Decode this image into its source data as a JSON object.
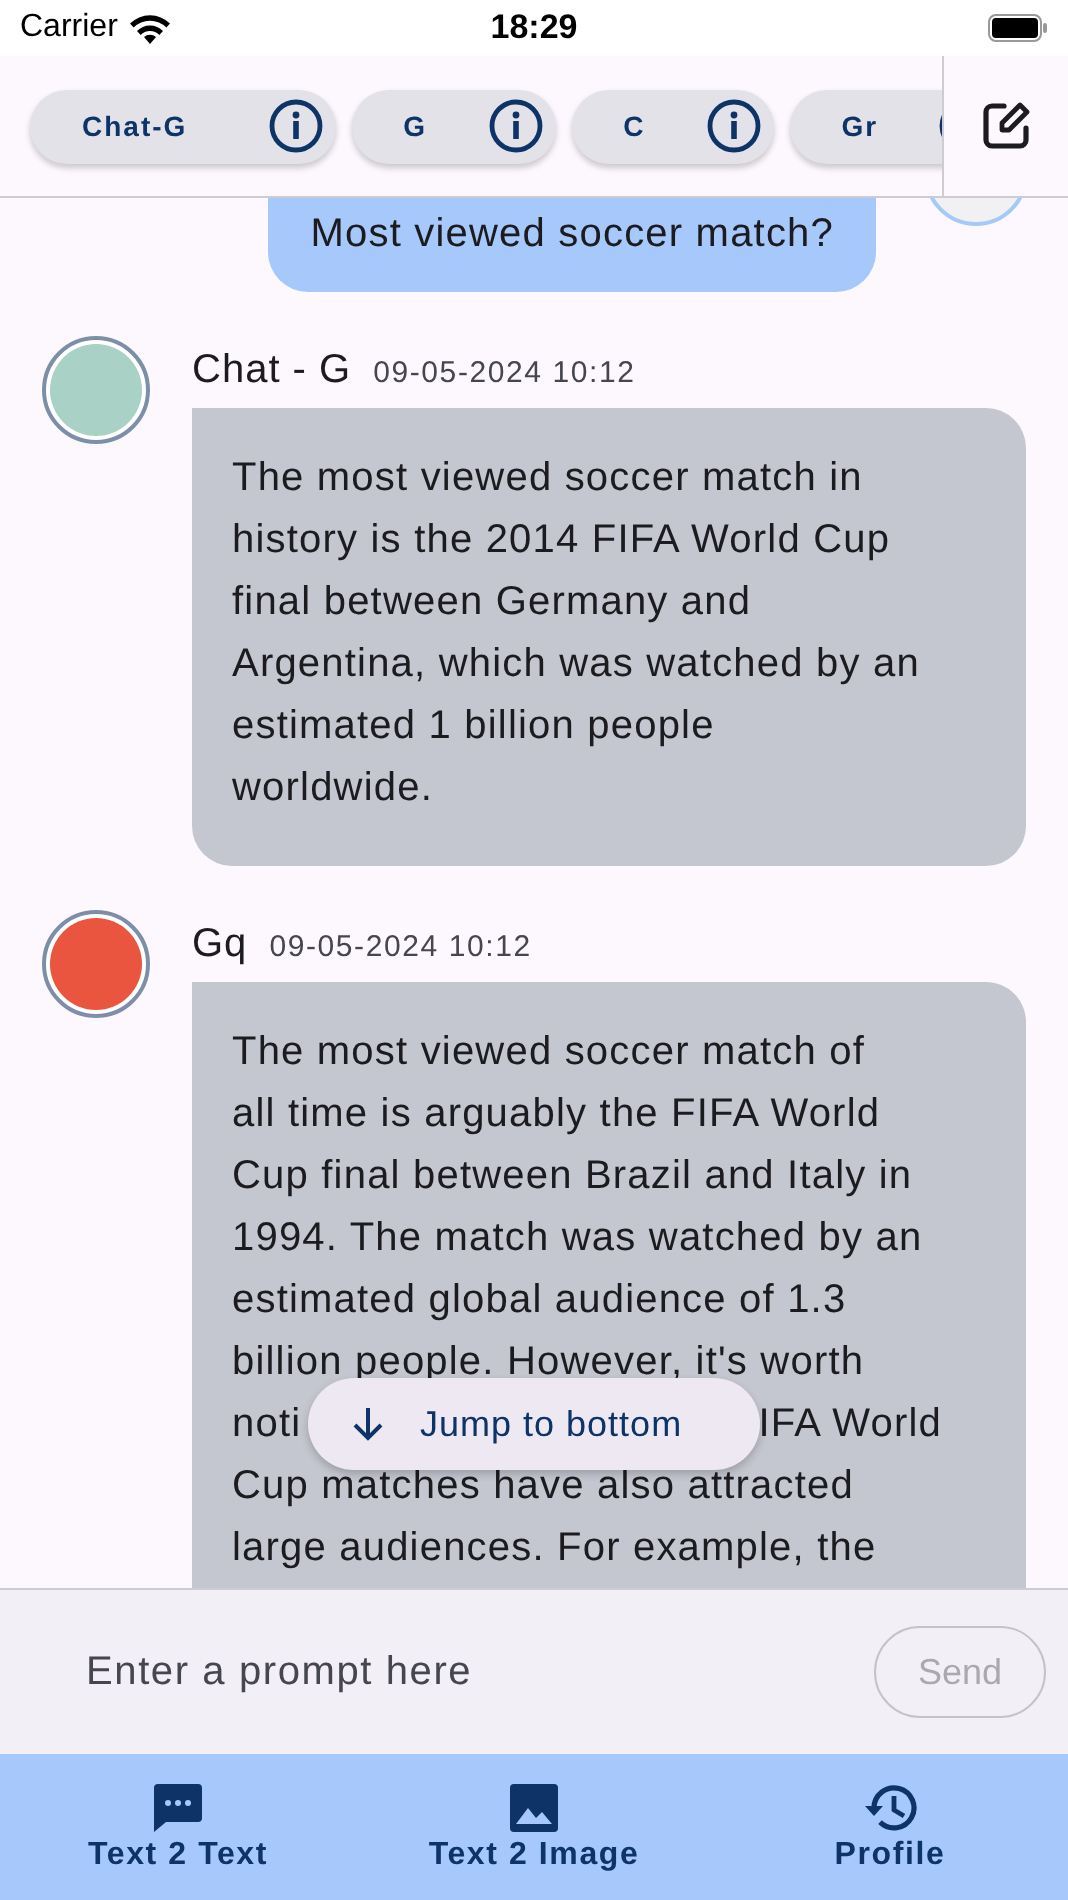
{
  "status_bar": {
    "carrier": "Carrier",
    "time": "18:29"
  },
  "model_chips": [
    {
      "label": "Chat-G"
    },
    {
      "label": "G"
    },
    {
      "label": "C"
    },
    {
      "label": "Gr"
    }
  ],
  "messages": [
    {
      "kind": "user",
      "lines": [
        "Most viewed soccer match?"
      ]
    },
    {
      "kind": "bot",
      "sender": "Chat - G",
      "time": "09-05-2024 10:12",
      "color": "#a9d1c5",
      "lines": [
        "The most viewed soccer match in",
        "history is the 2014 FIFA World Cup",
        "final between Germany and",
        "Argentina, which was watched by an",
        "estimated 1 billion people",
        "worldwide."
      ]
    },
    {
      "kind": "bot",
      "sender": "Gq",
      "time": "09-05-2024 10:12",
      "color": "#e9553e",
      "lines": [
        "The most viewed soccer match of",
        "all time is arguably the FIFA World",
        "Cup final between Brazil and Italy in",
        "1994. The match was watched by an",
        "estimated global audience of 1.3",
        "billion people. However, it's worth",
        [
          "noti",
          "IFA World"
        ],
        "Cup matches have also attracted",
        "large audiences. For example, the"
      ]
    }
  ],
  "jump_button": {
    "label": "Jump to bottom"
  },
  "prompt": {
    "placeholder": "Enter a prompt here",
    "send": {
      "label": "Send",
      "disabled": true
    }
  },
  "nav": [
    {
      "label": "Text 2 Text",
      "kind": "chat"
    },
    {
      "label": "Text 2 Image",
      "kind": "image"
    },
    {
      "label": "Profile",
      "kind": "history"
    }
  ]
}
